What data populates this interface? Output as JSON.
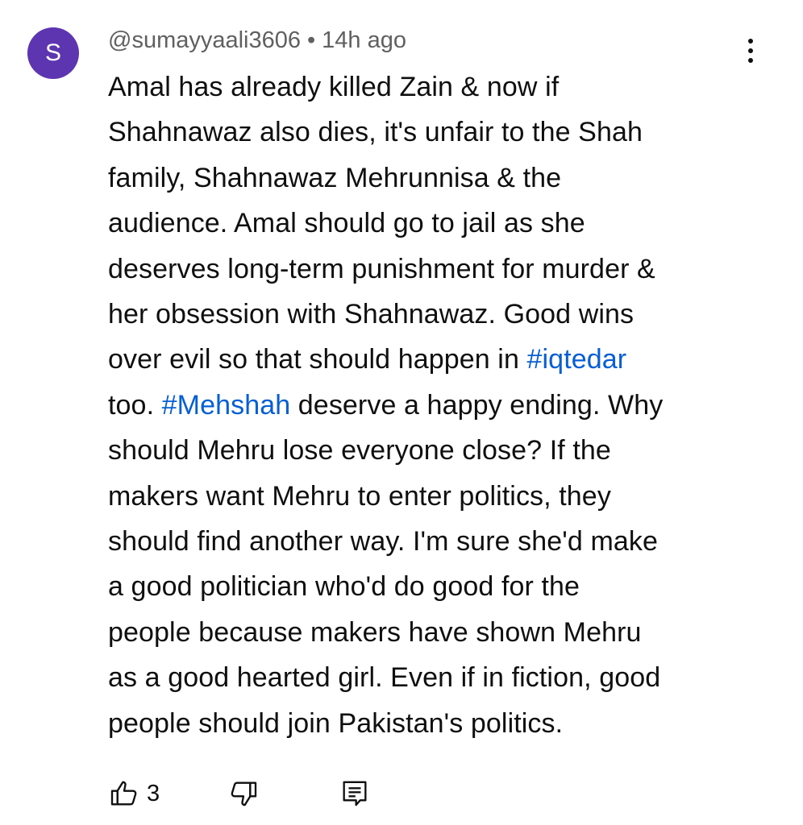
{
  "comment": {
    "avatar_letter": "S",
    "author": "@sumayyaali3606",
    "separator": "•",
    "time": "14h ago",
    "lines": [
      [
        "Amal has already killed Zain & now if"
      ],
      [
        "Shahnawaz also dies, it's unfair to the Shah"
      ],
      [
        "family, Shahnawaz Mehrunnisa & the"
      ],
      [
        "audience. Amal should go to jail as she"
      ],
      [
        "deserves long-term punishment for murder &"
      ],
      [
        "her obsession with Shahnawaz. Good wins"
      ],
      [
        "over evil so that should happen in ",
        "#iqtedar"
      ],
      [
        "too. ",
        "#Mehshah",
        " deserve a happy ending.  Why"
      ],
      [
        "should Mehru lose everyone close? If the"
      ],
      [
        "makers want Mehru to enter politics, they"
      ],
      [
        "should find another way. I'm sure she'd make"
      ],
      [
        "a good politician who'd do good for the"
      ],
      [
        "people because makers have shown Mehru"
      ],
      [
        "as a good hearted girl. Even if in fiction, good"
      ],
      [
        "people should join Pakistan's politics."
      ]
    ],
    "hashtags": [
      "#iqtedar",
      "#Mehshah"
    ],
    "like_count": "3"
  },
  "colors": {
    "avatar_bg": "#5e35b1",
    "hashtag": "#065fd4",
    "meta_text": "#606060",
    "body_text": "#0f0f0f"
  },
  "icons": {
    "like": "thumbs-up-icon",
    "dislike": "thumbs-down-icon",
    "reply": "reply-comment-icon",
    "more": "vertical-dots-icon"
  }
}
